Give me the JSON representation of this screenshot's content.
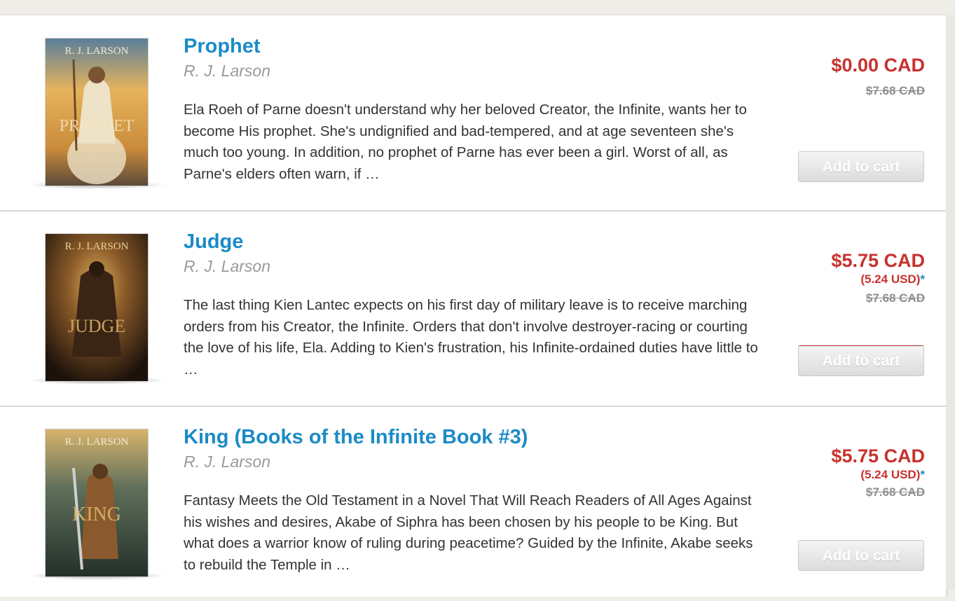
{
  "books": [
    {
      "title": "Prophet",
      "author": "R. J. Larson",
      "description": "Ela Roeh of Parne doesn't understand why her beloved Creator, the Infinite, wants her to become His prophet. She's undignified and bad-tempered, and at age seventeen she's much too young. In addition, no prophet of Parne has ever been a girl. Worst of all, as Parne's elders often warn, if …",
      "price": "$0.00 CAD",
      "original_price": "$7.68 CAD",
      "cart_label": "Add to cart",
      "cover": {
        "author_text": "R. J. LARSON",
        "title_text": "PROPHET",
        "colors": [
          "#c98b3b",
          "#e6b35c",
          "#5b4a3a"
        ]
      }
    },
    {
      "title": "Judge",
      "author": "R. J. Larson",
      "description": "The last thing Kien Lantec expects on his first day of military leave is to receive marching orders from his Creator, the Infinite. Orders that don't involve destroyer-racing or courting the love of his life, Ela. Adding to Kien's frustration, his Infinite-ordained duties have little to …",
      "price": "$5.75 CAD",
      "usd_price": "(5.24 USD)",
      "usd_marker": "*",
      "original_price": "$7.68 CAD",
      "cart_label": "Add to cart",
      "cover": {
        "author_text": "R. J. LARSON",
        "title_text": "JUDGE",
        "colors": [
          "#3a2414",
          "#b07a35",
          "#1c120b"
        ]
      }
    },
    {
      "title": "King (Books of the Infinite Book #3)",
      "author": "R. J. Larson",
      "description": "Fantasy Meets the Old Testament in a Novel That Will Reach Readers of All Ages Against his wishes and desires, Akabe of Siphra has been chosen by his people to be King. But what does a warrior know of ruling during peacetime? Guided by the Infinite, Akabe seeks to rebuild the Temple in …",
      "price": "$5.75 CAD",
      "usd_price": "(5.24 USD)",
      "usd_marker": "*",
      "original_price": "$7.68 CAD",
      "cart_label": "Add to cart",
      "cover": {
        "author_text": "R. J. LARSON",
        "title_text": "KING",
        "colors": [
          "#2f4a3a",
          "#b89050",
          "#23302a"
        ]
      }
    }
  ],
  "colors": {
    "title": "#1c8bc7",
    "price": "#c8312d",
    "original_price": "#8e8e8e",
    "text": "#333333"
  }
}
